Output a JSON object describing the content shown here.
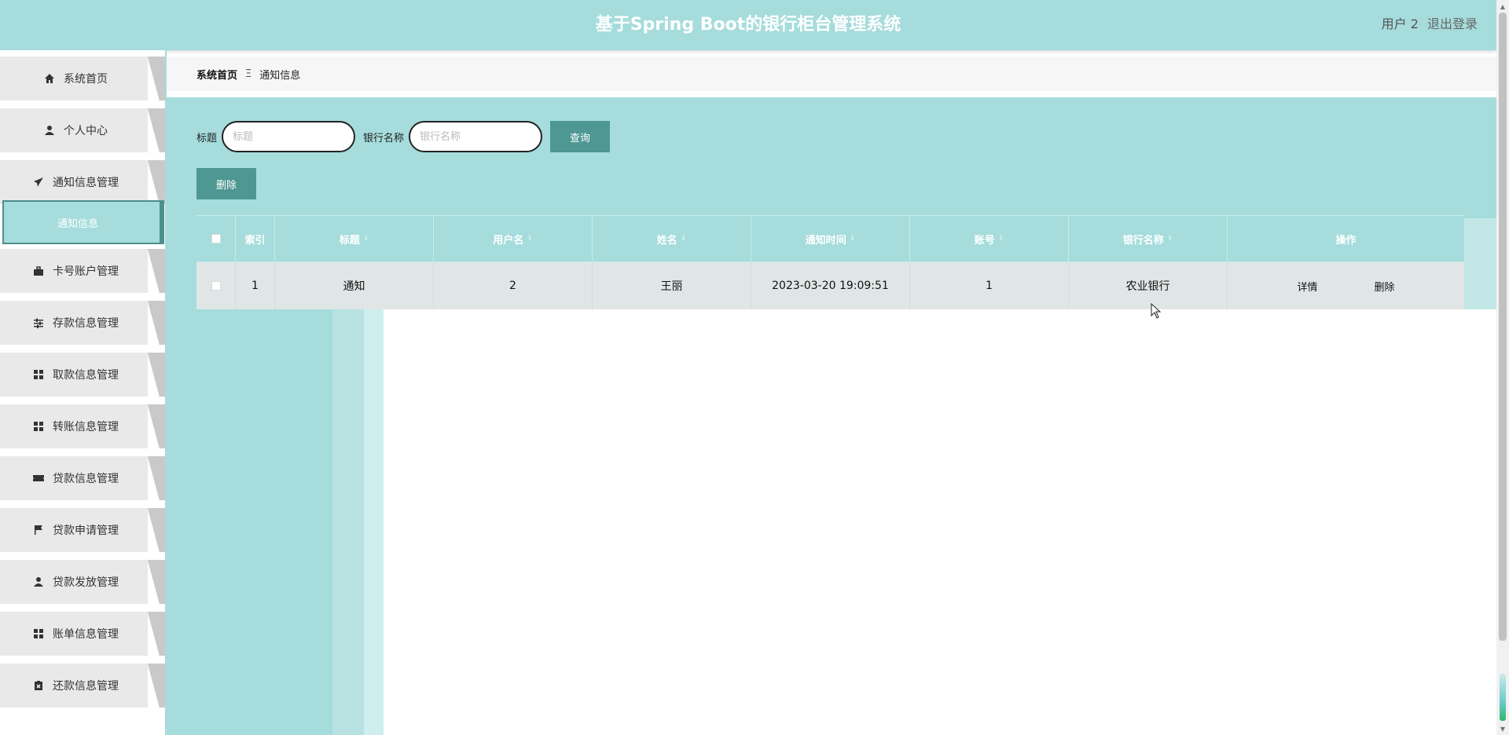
{
  "header": {
    "title": "基于Spring Boot的银行柜台管理系统",
    "user_label": "用户 2",
    "logout_label": "退出登录"
  },
  "sidebar": {
    "items": [
      {
        "label": "系统首页",
        "icon": "home-icon"
      },
      {
        "label": "个人中心",
        "icon": "user-icon"
      },
      {
        "label": "通知信息管理",
        "icon": "send-icon"
      },
      {
        "label": "卡号账户管理",
        "icon": "briefcase-icon"
      },
      {
        "label": "存款信息管理",
        "icon": "sliders-icon"
      },
      {
        "label": "取款信息管理",
        "icon": "grid-icon"
      },
      {
        "label": "转账信息管理",
        "icon": "grid-icon"
      },
      {
        "label": "贷款信息管理",
        "icon": "ticket-icon"
      },
      {
        "label": "贷款申请管理",
        "icon": "flag-icon"
      },
      {
        "label": "贷款发放管理",
        "icon": "user-icon"
      },
      {
        "label": "账单信息管理",
        "icon": "grid-icon"
      },
      {
        "label": "还款信息管理",
        "icon": "clipboard-x-icon"
      }
    ],
    "active_submenu": "通知信息"
  },
  "breadcrumb": {
    "home": "系统首页",
    "separator": "Ξ",
    "current": "通知信息"
  },
  "search": {
    "title_label": "标题",
    "title_placeholder": "标题",
    "bank_label": "银行名称",
    "bank_placeholder": "银行名称",
    "query_label": "查询"
  },
  "toolbar": {
    "delete_label": "删除"
  },
  "table": {
    "columns": [
      "索引",
      "标题",
      "用户名",
      "姓名",
      "通知时间",
      "账号",
      "银行名称",
      "操作"
    ],
    "rows": [
      {
        "index": "1",
        "title": "通知",
        "username": "2",
        "name": "王丽",
        "time": "2023-03-20 19:09:51",
        "account": "1",
        "bank": "农业银行",
        "detail_label": "详情",
        "delete_label": "删除"
      }
    ]
  },
  "colors": {
    "accent": "#a6dcdc",
    "button": "#4e9793",
    "sidebar_item": "#e9e9e9"
  }
}
